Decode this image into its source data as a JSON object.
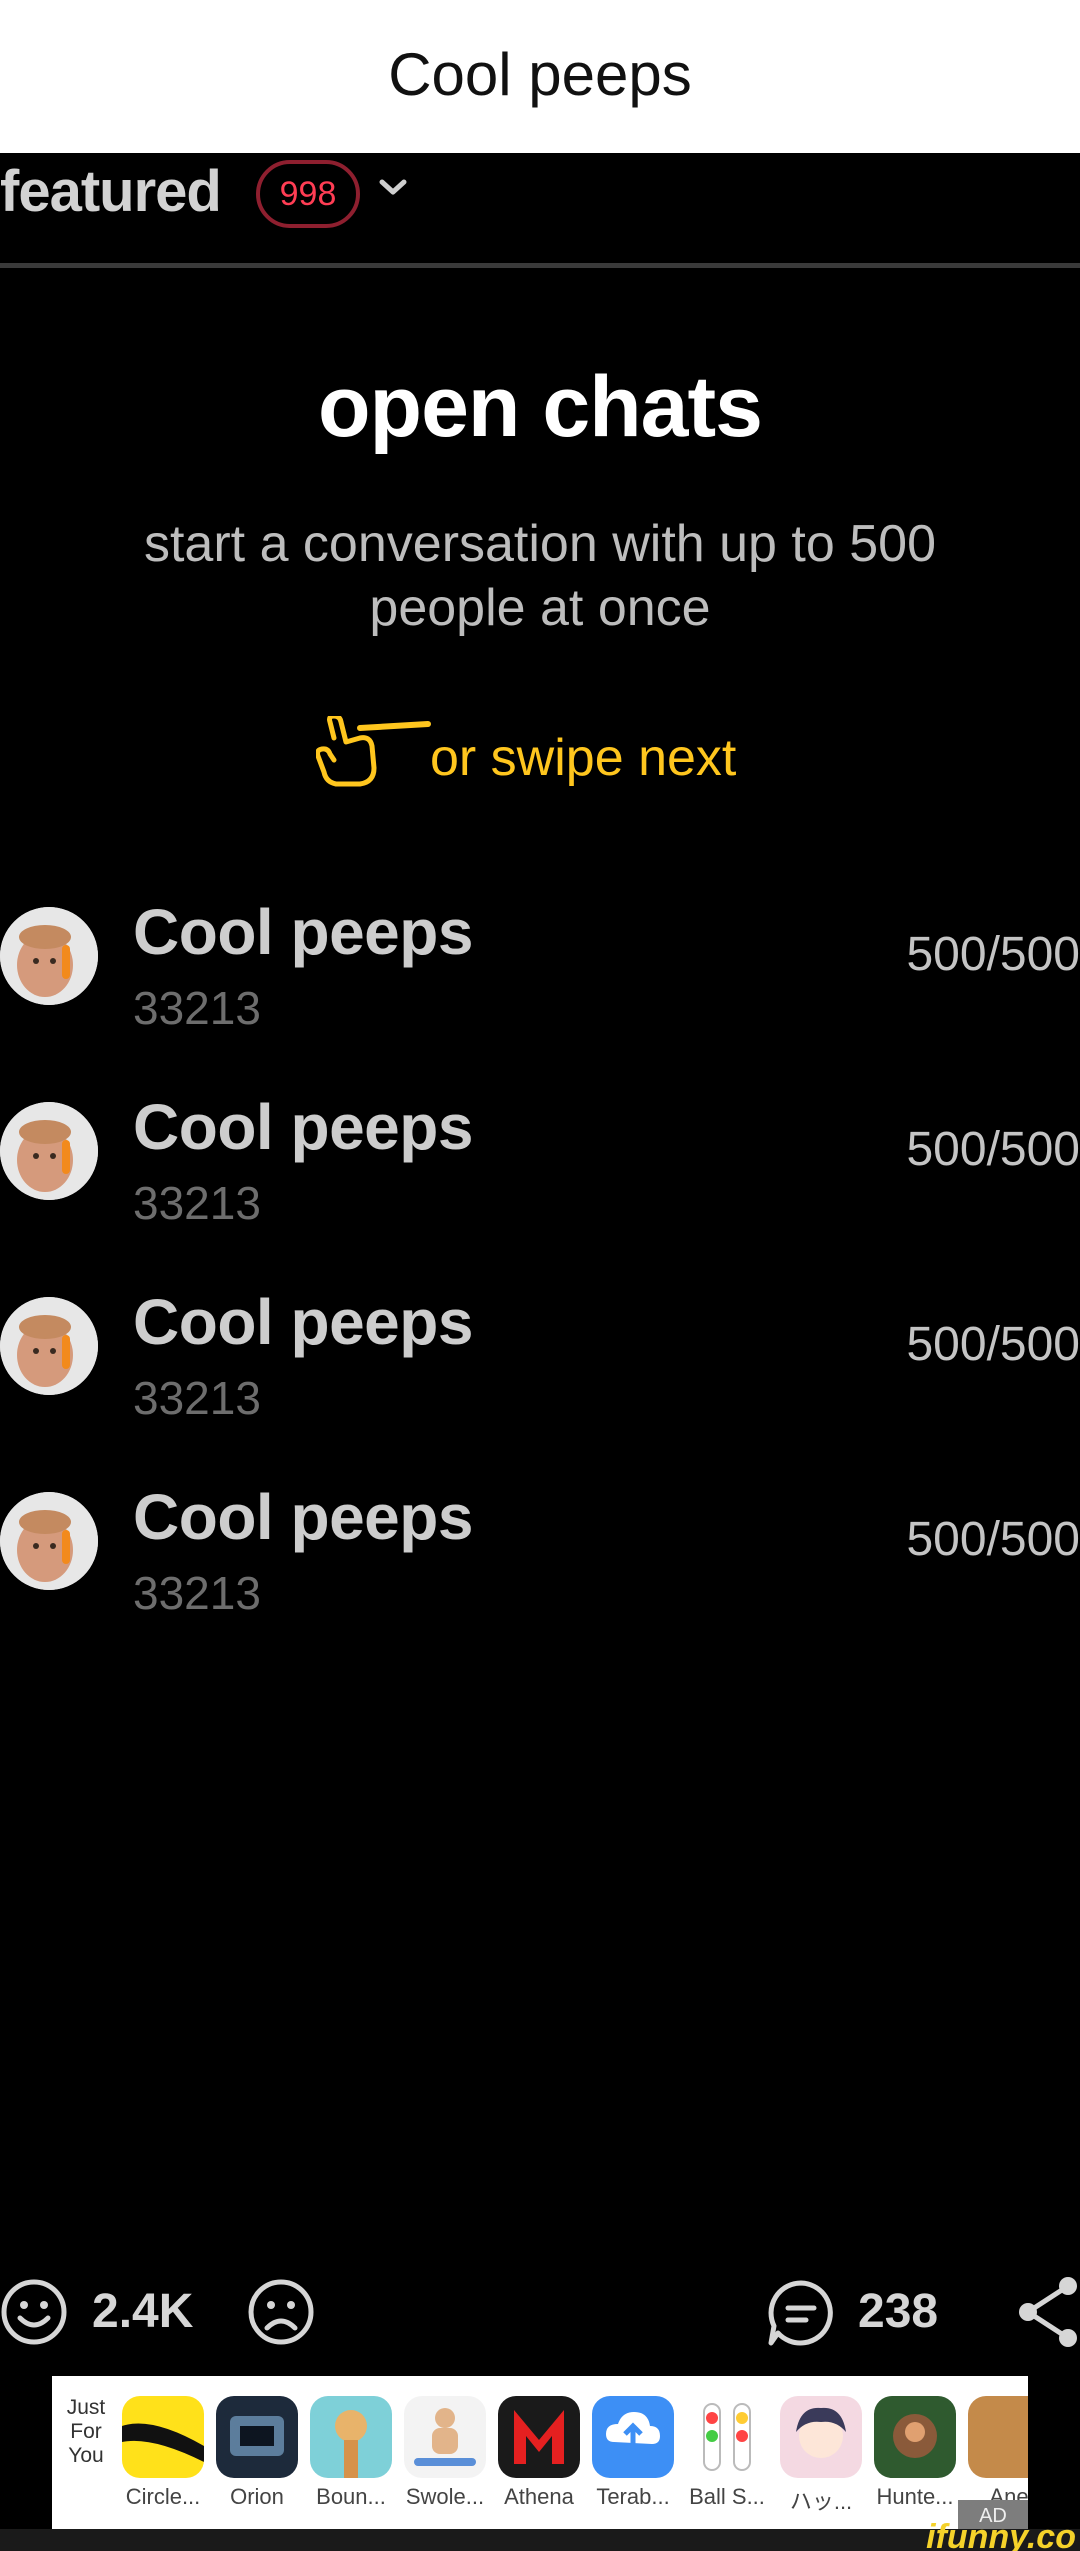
{
  "caption": {
    "title": "Cool peeps"
  },
  "featured": {
    "label": "featured",
    "badge": "998"
  },
  "intro": {
    "headline": "open chats",
    "subtitle": "start a conversation with up to 500 people at once",
    "swipe_hint": "or swipe next"
  },
  "chats": [
    {
      "name": "Cool peeps",
      "members": "33213",
      "capacity": "500/500"
    },
    {
      "name": "Cool peeps",
      "members": "33213",
      "capacity": "500/500"
    },
    {
      "name": "Cool peeps",
      "members": "33213",
      "capacity": "500/500"
    },
    {
      "name": "Cool peeps",
      "members": "33213",
      "capacity": "500/500"
    }
  ],
  "reactions": {
    "likes": "2.4K",
    "comments": "238"
  },
  "ad": {
    "heading": "Just For You",
    "mark": "AD",
    "apps": [
      {
        "label": "Circle...",
        "color": "#ffe11a"
      },
      {
        "label": "Orion",
        "color": "#1d2a3b"
      },
      {
        "label": "Boun...",
        "color": "#7ed0d8"
      },
      {
        "label": "Swole...",
        "color": "#f3f3f3"
      },
      {
        "label": "Athena",
        "color": "#1a1a1a"
      },
      {
        "label": "Terab...",
        "color": "#3d8ff5"
      },
      {
        "label": "Ball S...",
        "color": "#ffffff"
      },
      {
        "label": "ハッ...",
        "color": "#f4d9e2"
      },
      {
        "label": "Hunte...",
        "color": "#2f5a2f"
      },
      {
        "label": "Ane",
        "color": "#c48a4a"
      }
    ]
  },
  "watermark": "ifunny.co"
}
